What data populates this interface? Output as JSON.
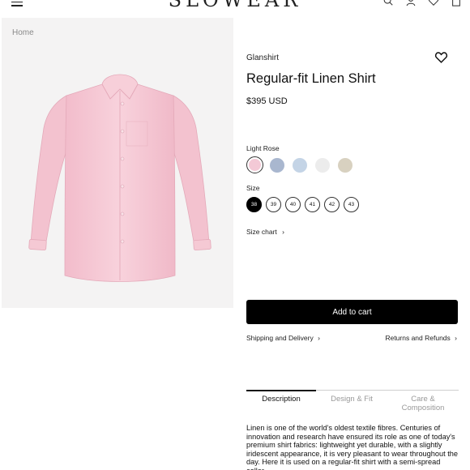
{
  "header": {
    "logo": "SLOWEAR",
    "icons": [
      "menu-icon",
      "search-icon",
      "user-icon",
      "heart-icon",
      "bag-icon"
    ]
  },
  "breadcrumb": "Home",
  "product": {
    "brand": "Glanshirt",
    "title": "Regular-fit Linen Shirt",
    "price": "$395 USD",
    "color_label": "Light Rose",
    "colors": [
      "#f3c9d6",
      "#a9b7cf",
      "#c4d4e6",
      "#ececec",
      "#d8d1c0"
    ],
    "selected_color_index": 0,
    "size_label": "Size",
    "sizes": [
      "38",
      "39",
      "40",
      "41",
      "42",
      "43"
    ],
    "selected_size": "38",
    "size_chart": "Size chart",
    "add_to_cart": "Add to cart",
    "shipping": "Shipping and Delivery",
    "returns": "Returns and Refunds",
    "chevron": "›"
  },
  "tabs": {
    "description": "Description",
    "design_fit": "Design & Fit",
    "care_1": "Care &",
    "care_2": "Composition"
  },
  "description": "Linen is one of the world's oldest textile fibres. Centuries of innovation and research have ensured its role as one of today's premium shirt fabrics: lightweight yet durable, with a slightly iridescent appearance, it is very pleasant to wear throughout the day. Here it is used on a regular-fit shirt with a semi-spread collar.",
  "colors": {
    "accent": "#000000",
    "shirt": "#f5c6d3"
  }
}
